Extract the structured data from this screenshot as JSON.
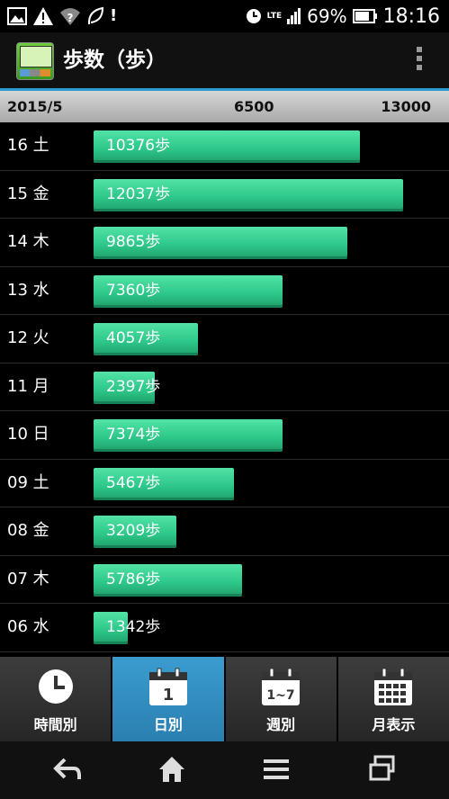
{
  "statusbar": {
    "battery": "69%",
    "time": "18:16",
    "network": "LTE"
  },
  "appbar": {
    "title": "歩数（歩）"
  },
  "scale": {
    "month": "2015/5",
    "mid": "6500",
    "max": "13000",
    "max_value": 13000
  },
  "rows": [
    {
      "label": "16 土",
      "steps": 10376,
      "text": "10376歩"
    },
    {
      "label": "15 金",
      "steps": 12037,
      "text": "12037歩"
    },
    {
      "label": "14 木",
      "steps": 9865,
      "text": "9865歩"
    },
    {
      "label": "13 水",
      "steps": 7360,
      "text": "7360歩"
    },
    {
      "label": "12 火",
      "steps": 4057,
      "text": "4057歩"
    },
    {
      "label": "11 月",
      "steps": 2397,
      "text": "2397歩"
    },
    {
      "label": "10 日",
      "steps": 7374,
      "text": "7374歩"
    },
    {
      "label": "09 土",
      "steps": 5467,
      "text": "5467歩"
    },
    {
      "label": "08 金",
      "steps": 3209,
      "text": "3209歩"
    },
    {
      "label": "07 木",
      "steps": 5786,
      "text": "5786歩"
    },
    {
      "label": "06 水",
      "steps": 1342,
      "text": "1342歩"
    }
  ],
  "tabs": [
    {
      "label": "時間別",
      "icon": "clock-icon",
      "selected": false
    },
    {
      "label": "日別",
      "icon": "calendar-day-icon",
      "selected": true,
      "badge": "1"
    },
    {
      "label": "週別",
      "icon": "calendar-week-icon",
      "selected": false,
      "badge": "1~7"
    },
    {
      "label": "月表示",
      "icon": "calendar-month-icon",
      "selected": false
    }
  ],
  "navbar": {
    "icons": [
      "back-icon",
      "home-icon",
      "menu-icon",
      "recent-apps-icon"
    ]
  }
}
